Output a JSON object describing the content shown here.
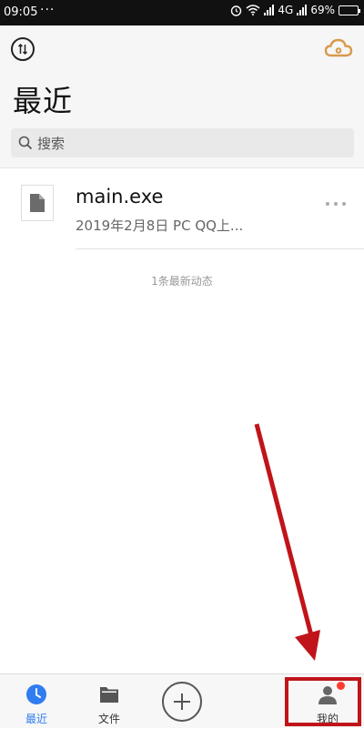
{
  "status_bar": {
    "time": "09:05",
    "dots": "···",
    "network": "4G",
    "battery": "69%"
  },
  "header": {
    "title": "最近",
    "search_placeholder": "搜索"
  },
  "files": [
    {
      "name": "main.exe",
      "meta": "2019年2月8日  PC QQ上..."
    }
  ],
  "activity_count": "1条最新动态",
  "bottom_nav": {
    "recent_label": "最近",
    "files_label": "文件",
    "mine_label": "我的"
  },
  "colors": {
    "accent": "#2f7df0",
    "cloud": "#d89a4c",
    "annotation": "#c0141a",
    "badge": "#ff3b30"
  },
  "icons": {
    "sort": "sort-arrows-icon",
    "cloud": "cloud-icon",
    "search": "search-icon",
    "file": "file-icon",
    "more": "more-icon",
    "recent": "clock-icon",
    "files": "folder-icon",
    "add": "plus-icon",
    "mine": "user-icon"
  }
}
